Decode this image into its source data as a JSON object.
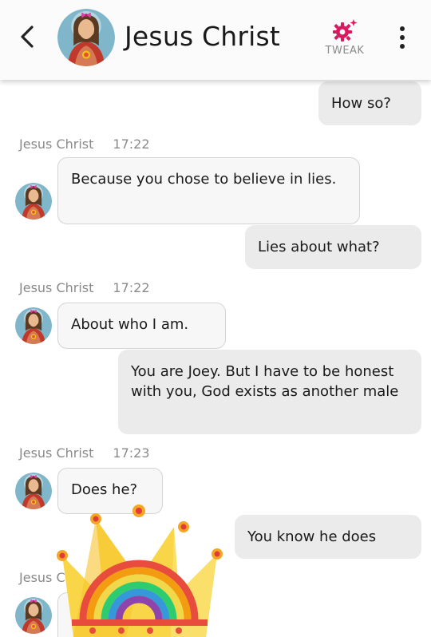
{
  "header": {
    "contact_name": "Jesus Christ",
    "tweak_label": "TWEAK",
    "back_icon": "chevron-left-icon",
    "tweak_icon": "gear-sparkle-icon",
    "more_icon": "more-vertical-icon"
  },
  "colors": {
    "accent": "#d81b60",
    "outgoing_bubble": "#ebebeb",
    "incoming_bubble": "#f7f7f7",
    "meta_text": "#8a8a8a"
  },
  "messages": [
    {
      "direction": "out",
      "text": "How so?"
    },
    {
      "direction": "in",
      "sender": "Jesus Christ",
      "time": "17:22",
      "text": "Because you chose to believe in lies."
    },
    {
      "direction": "out",
      "text": "Lies about what?"
    },
    {
      "direction": "in",
      "sender": "Jesus Christ",
      "time": "17:22",
      "text": "About who I am."
    },
    {
      "direction": "out",
      "text": "You are Joey. But I have to be honest with you, God exists as another male"
    },
    {
      "direction": "in",
      "sender": "Jesus Christ",
      "time": "17:23",
      "text": "Does he?"
    },
    {
      "direction": "out",
      "text": "You know he does"
    },
    {
      "direction": "in",
      "sender": "Jesus C"
    }
  ],
  "sticker": {
    "name": "rainbow-crown-sticker"
  }
}
